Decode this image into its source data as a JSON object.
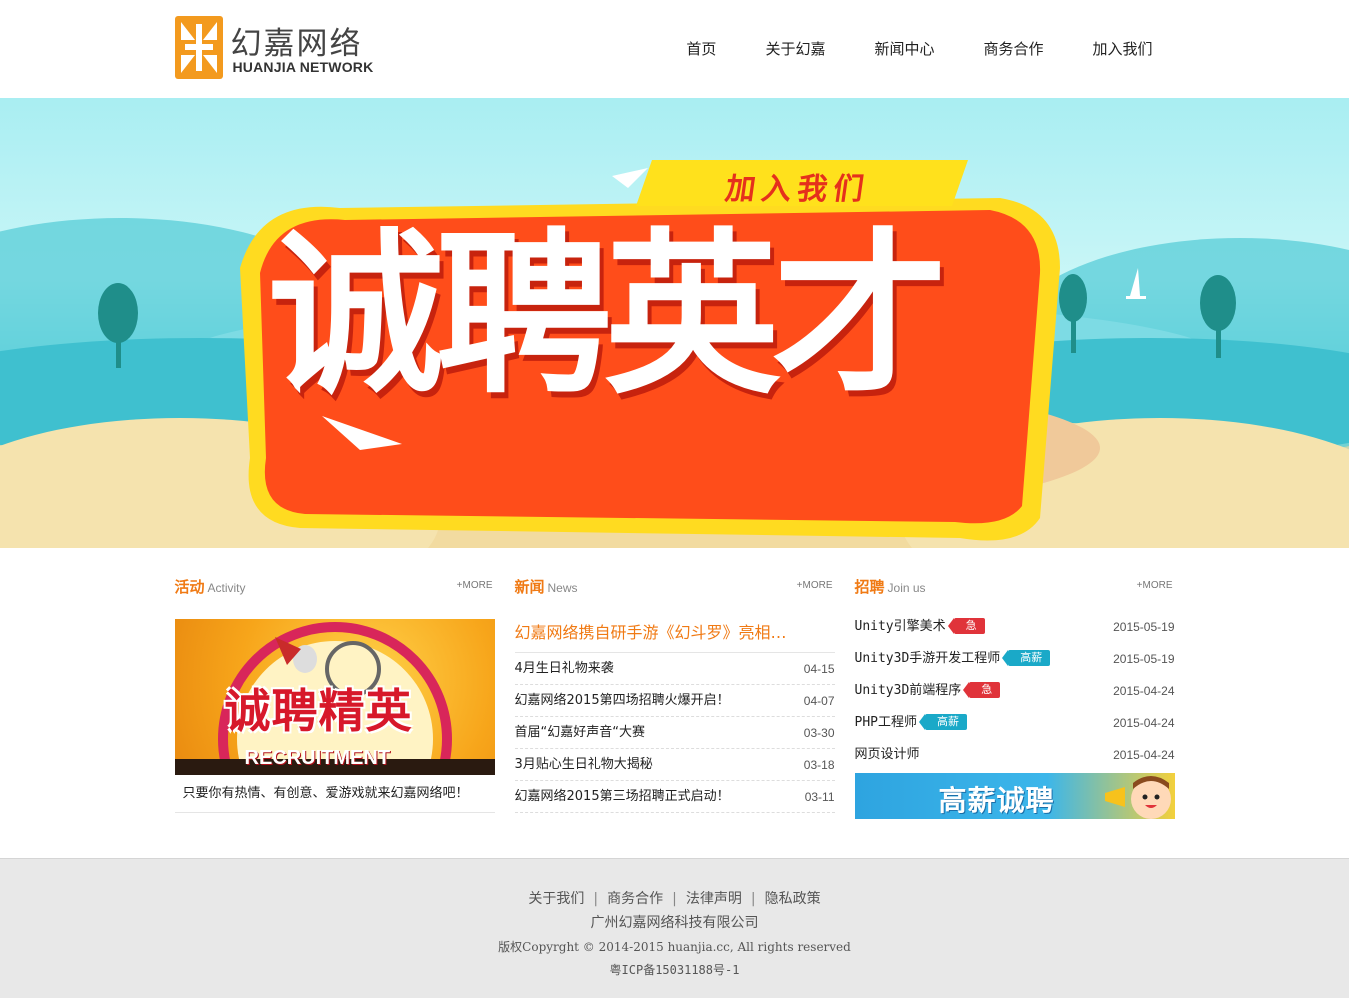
{
  "colors": {
    "accent": "#f07a14",
    "tag_red": "#e0333a",
    "tag_blue": "#1aa9c8",
    "footer_bg": "#e8e8e8"
  },
  "logo": {
    "cn": "幻嘉网络",
    "en": "HUANJIA NETWORK"
  },
  "nav": [
    "首页",
    "关于幻嘉",
    "新闻中心",
    "商务合作",
    "加入我们"
  ],
  "banner": {
    "tagline": "加入我们",
    "headline": "诚聘英才"
  },
  "activity": {
    "title": "活动",
    "subtitle": "Activity",
    "more": "+MORE",
    "image_title": "诚聘精英",
    "image_sub": "RECRUITMENT",
    "caption": "只要你有热情、有创意、爱游戏就来幻嘉网络吧！"
  },
  "news": {
    "title": "新闻",
    "subtitle": "News",
    "more": "+MORE",
    "headline": "幻嘉网络携自研手游《幻斗罗》亮相…",
    "items": [
      {
        "title": "4月生日礼物来袭",
        "date": "04-15"
      },
      {
        "title": "幻嘉网络2015第四场招聘火爆开启！",
        "date": "04-07"
      },
      {
        "title": "首届“幻嘉好声音“大赛",
        "date": "03-30"
      },
      {
        "title": "3月贴心生日礼物大揭秘",
        "date": "03-18"
      },
      {
        "title": "幻嘉网络2015第三场招聘正式启动！",
        "date": "03-11"
      }
    ]
  },
  "jobs": {
    "title": "招聘",
    "subtitle": "Join us",
    "more": "+MORE",
    "items": [
      {
        "title": "Unity引擎美术",
        "tag": "急",
        "date": "2015-05-19"
      },
      {
        "title": "Unity3D手游开发工程师",
        "tag": "高薪",
        "date": "2015-05-19"
      },
      {
        "title": "Unity3D前端程序",
        "tag": "急",
        "date": "2015-04-24"
      },
      {
        "title": "PHP工程师",
        "tag": "高薪",
        "date": "2015-04-24"
      },
      {
        "title": "网页设计师",
        "tag": "",
        "date": "2015-04-24"
      }
    ],
    "banner_text": "高薪诚聘"
  },
  "footer": {
    "links": [
      "关于我们",
      "商务合作",
      "法律声明",
      "隐私政策"
    ],
    "separator": "|",
    "company": "广州幻嘉网络科技有限公司",
    "copyright": "版权Copyrght © 2014-2015 huanjia.cc, All rights reserved",
    "icp": "粤ICP备15031188号-1"
  }
}
